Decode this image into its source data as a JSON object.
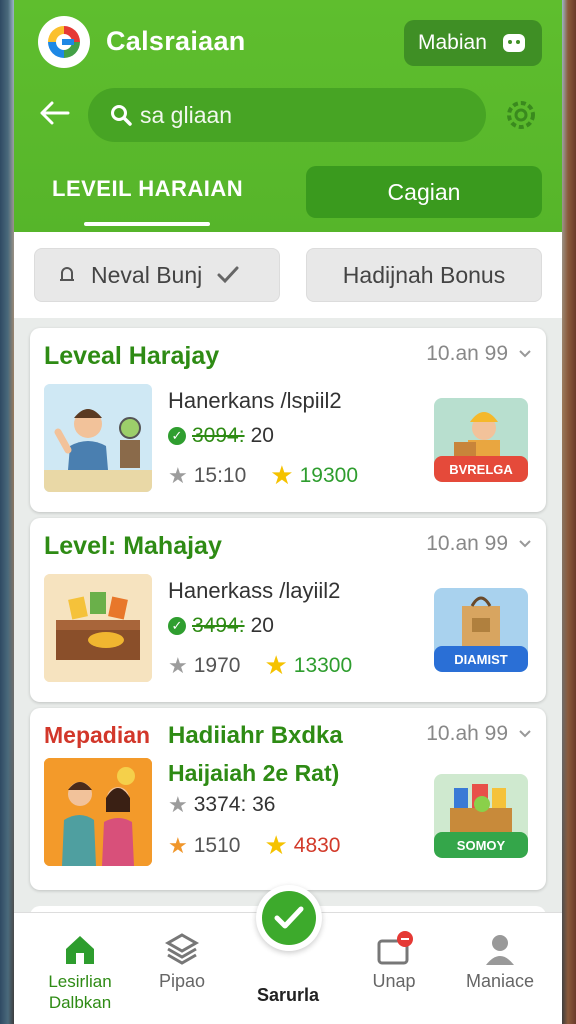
{
  "app": {
    "title": "Calsraiaan"
  },
  "header": {
    "mabian_label": "Mabian",
    "search_placeholder": "sa gliaan"
  },
  "tabs": [
    {
      "label": "LEVEIL HARAIAN",
      "active": true
    },
    {
      "label": "Cagian",
      "active": false
    }
  ],
  "filters": [
    {
      "label": "Neval Bunj"
    },
    {
      "label": "Hadijnah Bonus"
    }
  ],
  "cards": [
    {
      "title": "Leveal Harajay",
      "date": "10.an 99",
      "name": "Hanerkans /lspiil2",
      "price_old": "3094:",
      "price": "20",
      "stat1": "15:10",
      "stat2": "19300",
      "badge": "BVRELGA",
      "badge_color": "#e54a3a"
    },
    {
      "title": "Level: Mahajay",
      "date": "10.an 99",
      "name": "Hanerkass /layiil2",
      "price_old": "3494:",
      "price": "20",
      "stat1": "1970",
      "stat2": "13300",
      "badge": "DIAMIST",
      "badge_color": "#2a6fd6"
    },
    {
      "title": "Mepadian",
      "title2": "Hadiiahr Bxdka",
      "subtitle": "Haijaiah 2e Rat)",
      "date": "10.ah 99",
      "price": "3374: 36",
      "stat1": "1510",
      "stat2": "4830",
      "badge": "SOMOY",
      "badge_color": "#34a64a"
    }
  ],
  "nav": [
    {
      "label": "Lesirlian\nDalbkan",
      "icon": "home-icon",
      "active": true
    },
    {
      "label": "Pipao",
      "icon": "layers-icon"
    },
    {
      "label": "Sarurla",
      "icon": "check-circle-icon"
    },
    {
      "label": "Unap",
      "icon": "inbox-icon",
      "badge": true
    },
    {
      "label": "Maniace",
      "icon": "user-icon"
    }
  ],
  "colors": {
    "brand_green": "#5fbe2e",
    "dark_green": "#3a9a1e",
    "title_green": "#2e8b14"
  }
}
